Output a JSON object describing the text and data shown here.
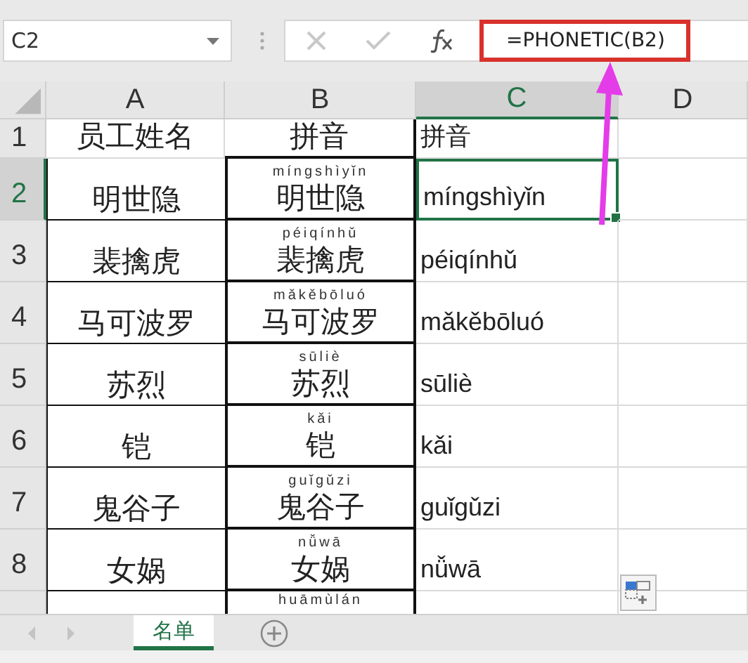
{
  "name_box": "C2",
  "formula": "=PHONETIC(B2)",
  "columns": [
    {
      "label": "A",
      "selected": false
    },
    {
      "label": "B",
      "selected": false
    },
    {
      "label": "C",
      "selected": true
    },
    {
      "label": "D",
      "selected": false
    }
  ],
  "rows": [
    {
      "number": "1",
      "selected": false,
      "a": "员工姓名",
      "b": "拼音",
      "c": "拼音"
    },
    {
      "number": "2",
      "selected": true,
      "a": "明世隐",
      "b_pinyin": "míngshìyǐn",
      "b": "明世隐",
      "c": "míngshìyǐn"
    },
    {
      "number": "3",
      "selected": false,
      "a": "裴擒虎",
      "b_pinyin": "péiqínhǔ",
      "b": "裴擒虎",
      "c": "péiqínhǔ"
    },
    {
      "number": "4",
      "selected": false,
      "a": "马可波罗",
      "b_pinyin": "mǎkěbōluó",
      "b": "马可波罗",
      "c": "mǎkěbōluó"
    },
    {
      "number": "5",
      "selected": false,
      "a": "苏烈",
      "b_pinyin": "sūliè",
      "b": "苏烈",
      "c": "sūliè"
    },
    {
      "number": "6",
      "selected": false,
      "a": "铠",
      "b_pinyin": "kǎi",
      "b": "铠",
      "c": "kǎi"
    },
    {
      "number": "7",
      "selected": false,
      "a": "鬼谷子",
      "b_pinyin": "guǐgǔzi",
      "b": "鬼谷子",
      "c": "guǐgǔzi"
    },
    {
      "number": "8",
      "selected": false,
      "a": "女娲",
      "b_pinyin": "nǚwā",
      "b": "女娲",
      "c": "nǚwā"
    },
    {
      "selected": false,
      "b_pinyin": "huāmùlán"
    }
  ],
  "sheet_tabs": [
    {
      "label": "名单",
      "selected": true
    }
  ]
}
